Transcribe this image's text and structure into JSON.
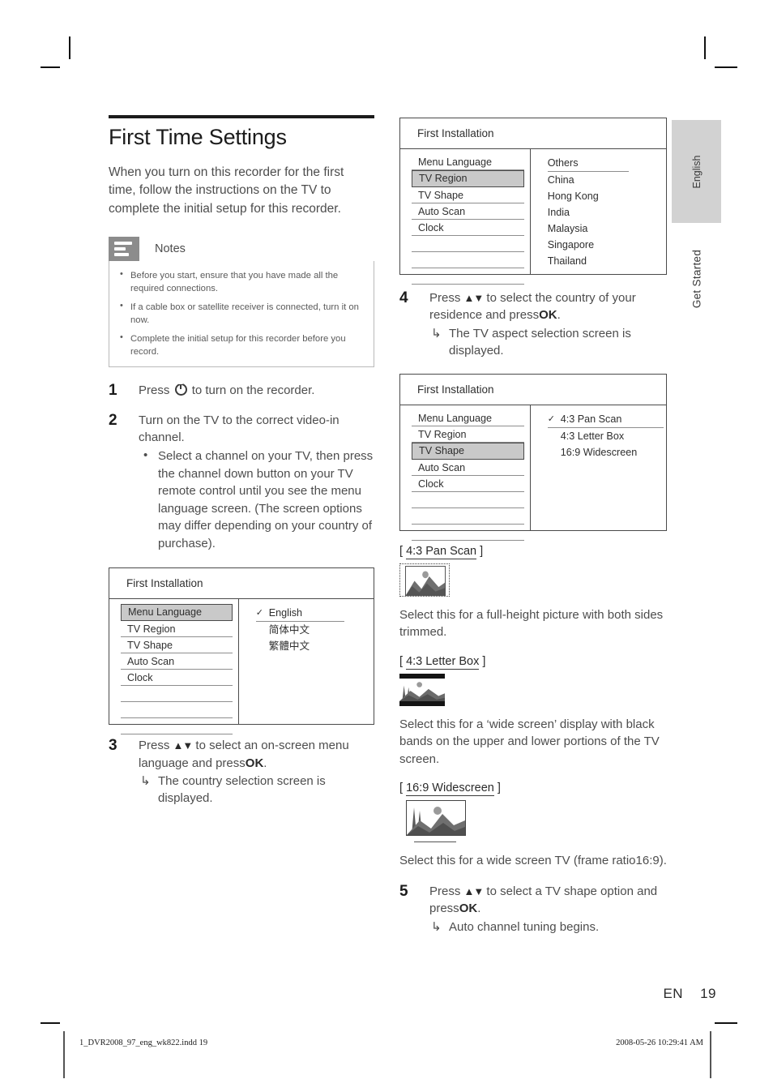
{
  "crop_marks": true,
  "left_column": {
    "title": "First Time Settings",
    "intro": "When you turn on this recorder for the first time, follow the instructions on the TV to complete the initial setup for this recorder.",
    "notes": {
      "label": "Notes",
      "icon": "notes-lines-icon",
      "items": [
        "Before you start, ensure that you have made all the required connections.",
        "If a cable box or satellite receiver is connected, turn it on now.",
        "Complete the initial setup for this recorder before you record."
      ]
    },
    "steps": [
      {
        "number": "1",
        "text_before": "Press",
        "icon": "power-icon",
        "text_after": "to turn on the recorder."
      },
      {
        "number": "2",
        "text": "Turn on the TV to the correct video-in channel.",
        "bullets": [
          "Select a channel on your TV, then press the channel down button on your TV remote control until you see the menu language screen. (The screen options may differ depending on your country of purchase)."
        ]
      },
      {
        "number": "3",
        "text_before": "Press",
        "arrows": "▲▼",
        "text_mid": "to select an on-screen menu language and press",
        "bold": "OK",
        "text_end": ".",
        "result": "The country selection screen is displayed."
      }
    ],
    "osd_menu_language": {
      "title": "First Installation",
      "menu_items": [
        "Menu Language",
        "TV Region",
        "TV Shape",
        "Auto Scan",
        "Clock"
      ],
      "selected_item": "Menu Language",
      "options": [
        "English",
        "简体中文",
        "繁體中文"
      ],
      "checked_option": "English"
    }
  },
  "right_column": {
    "osd_tv_region": {
      "title": "First Installation",
      "menu_items": [
        "Menu Language",
        "TV Region",
        "TV Shape",
        "Auto Scan",
        "Clock"
      ],
      "selected_item": "TV Region",
      "options": [
        "Others",
        "China",
        "Hong Kong",
        "India",
        "Malaysia",
        "Singapore",
        "Thailand"
      ],
      "checked_option": ""
    },
    "step4": {
      "number": "4",
      "text_before": "Press",
      "arrows": "▲▼",
      "text_mid": "to select the country of your residence and press",
      "bold": "OK",
      "text_end": ".",
      "result": "The TV aspect selection screen is displayed."
    },
    "osd_tv_shape": {
      "title": "First Installation",
      "menu_items": [
        "Menu Language",
        "TV Region",
        "TV Shape",
        "Auto Scan",
        "Clock"
      ],
      "selected_item": "TV Shape",
      "options": [
        "4:3 Pan Scan",
        "4:3 Letter Box",
        "16:9 Widescreen"
      ],
      "checked_option": "4:3 Pan Scan"
    },
    "aspect_blocks": [
      {
        "heading_open": "[",
        "heading_label": "4:3 Pan Scan",
        "heading_close": "]",
        "thumbnail": "tv-pan-scan-thumbnail",
        "description": "Select this for a full-height picture with both sides trimmed."
      },
      {
        "heading_open": "[",
        "heading_label": "4:3 Letter Box",
        "heading_close": "]",
        "thumbnail": "tv-letter-box-thumbnail",
        "description": "Select this for a ‘wide screen’ display with black bands on the upper and lower portions of the TV screen."
      },
      {
        "heading_open": "[",
        "heading_label": "16:9 Widescreen",
        "heading_close": "]",
        "thumbnail": "tv-widescreen-thumbnail",
        "description": "Select this for a wide screen TV (frame ratio16:9)."
      }
    ],
    "step5": {
      "number": "5",
      "text_before": "Press",
      "arrows": "▲▼",
      "text_mid": "to select a TV shape option and press",
      "bold": "OK",
      "text_end": ".",
      "result": "Auto channel tuning begins."
    }
  },
  "side_tabs": {
    "language_tab": "English",
    "section_tab": "Get Started"
  },
  "footer": {
    "locale_code": "EN",
    "page_number": "19",
    "imprint_file": "1_DVR2008_97_eng_wk822.indd   19",
    "imprint_timestamp": "2008-05-26   10:29:41 AM"
  }
}
